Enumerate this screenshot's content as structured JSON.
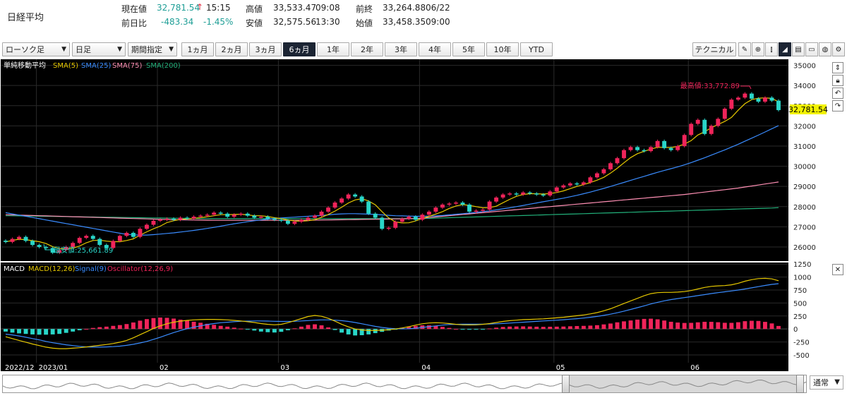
{
  "quote": {
    "title": "日経平均",
    "current_label": "現在値",
    "current_value": "32,781.54",
    "current_arrow": "↑",
    "current_time": "15:15",
    "high_label": "高値",
    "high_value": "33,533.47",
    "high_time": "09:08",
    "prev_label": "前終",
    "prev_value": "33,264.88",
    "prev_date": "06/22",
    "change_label": "前日比",
    "change_value": "-483.34",
    "change_pct": "-1.45%",
    "low_label": "安値",
    "low_value": "32,575.56",
    "low_time": "13:30",
    "open_label": "始値",
    "open_value": "33,458.35",
    "open_time": "09:00"
  },
  "toolbar": {
    "chart_type": "ローソク足",
    "interval": "日足",
    "period_select": "期間指定",
    "periods": [
      "1ヵ月",
      "2ヵ月",
      "3ヵ月",
      "6ヵ月",
      "1年",
      "2年",
      "3年",
      "4年",
      "5年",
      "10年",
      "YTD"
    ],
    "active_period": "6ヵ月",
    "technical": "テクニカル"
  },
  "navigator": {
    "mode": "通常"
  },
  "colors": {
    "background": "#000000",
    "up": "#f0245a",
    "down": "#29d6c8",
    "sma5": "#e6c800",
    "sma25": "#3a8cff",
    "sma75": "#ff8fb4",
    "sma200": "#22b07a",
    "macd": "#e6c800",
    "signal": "#3a8cff",
    "osc_pos": "#f0245a",
    "osc_neg": "#29d6c8"
  },
  "chart_data": [
    {
      "type": "candlestick",
      "legend": [
        "単純移動平均",
        "SMA(5)",
        "SMA(25)",
        "SMA(75)",
        "SMA(200)"
      ],
      "ylim": [
        25300,
        35300
      ],
      "yticks": [
        26000,
        27000,
        28000,
        29000,
        30000,
        31000,
        32000,
        33000,
        34000,
        35000
      ],
      "ytick_labels": [
        "26000",
        "27000",
        "28000",
        "29000",
        "30000",
        "31000",
        "32000",
        "33000",
        "34000",
        "35000"
      ],
      "x_labels": [
        "2022/12",
        "2023/01",
        "02",
        "03",
        "04",
        "05",
        "06"
      ],
      "current_price_label": "32,781.54",
      "annotations": {
        "high": "最高値:33,772.89",
        "low": "最安値:25,661.89"
      },
      "close": [
        26250,
        26400,
        26500,
        26300,
        26100,
        26000,
        25950,
        25716,
        25850,
        26000,
        26200,
        26450,
        26550,
        26400,
        26100,
        25950,
        26300,
        26550,
        26700,
        26500,
        26900,
        27100,
        27300,
        27350,
        27400,
        27350,
        27450,
        27400,
        27500,
        27550,
        27600,
        27700,
        27650,
        27500,
        27600,
        27650,
        27550,
        27450,
        27500,
        27400,
        27350,
        27300,
        27150,
        27250,
        27350,
        27450,
        27550,
        27750,
        27950,
        28200,
        28400,
        28600,
        28500,
        28250,
        27650,
        27450,
        26900,
        26950,
        27250,
        27400,
        27500,
        27350,
        27600,
        27750,
        27950,
        28100,
        28150,
        28200,
        28100,
        27750,
        27800,
        27850,
        28250,
        28450,
        28600,
        28650,
        28600,
        28700,
        28650,
        28600,
        28550,
        28750,
        28950,
        29050,
        29150,
        29100,
        29200,
        29450,
        29650,
        29850,
        30150,
        30400,
        30800,
        30950,
        30800,
        30750,
        30950,
        31250,
        30900,
        30800,
        31000,
        31550,
        32100,
        32300,
        31600,
        32000,
        32350,
        32850,
        33300,
        33400,
        33600,
        33350,
        33200,
        33400,
        33250,
        32781.54
      ],
      "sma25": [
        27700,
        27640,
        27580,
        27520,
        27460,
        27400,
        27340,
        27280,
        27220,
        27160,
        27100,
        27040,
        26980,
        26920,
        26860,
        26800,
        26740,
        26680,
        26620,
        26600,
        26590,
        26590,
        26610,
        26640,
        26670,
        26700,
        26740,
        26780,
        26820,
        26870,
        26920,
        26970,
        27030,
        27090,
        27150,
        27200,
        27250,
        27300,
        27340,
        27380,
        27410,
        27440,
        27460,
        27480,
        27500,
        27520,
        27540,
        27560,
        27590,
        27620,
        27640,
        27650,
        27650,
        27640,
        27630,
        27610,
        27590,
        27570,
        27550,
        27540,
        27530,
        27520,
        27520,
        27530,
        27540,
        27560,
        27590,
        27620,
        27650,
        27680,
        27710,
        27750,
        27790,
        27840,
        27890,
        27940,
        28000,
        28060,
        28120,
        28180,
        28240,
        28300,
        28360,
        28420,
        28490,
        28560,
        28640,
        28720,
        28810,
        28900,
        29000,
        29100,
        29200,
        29300,
        29400,
        29500,
        29600,
        29700,
        29790,
        29880,
        29970,
        30070,
        30180,
        30300,
        30420,
        30550,
        30680,
        30810,
        30950,
        31090,
        31240,
        31390,
        31540,
        31700,
        31860,
        32010
      ],
      "sma75": [
        27600,
        27590,
        27580,
        27570,
        27560,
        27550,
        27540,
        27530,
        27520,
        27510,
        27500,
        27490,
        27480,
        27470,
        27460,
        27450,
        27440,
        27430,
        27420,
        27410,
        27400,
        27390,
        27380,
        27370,
        27360,
        27350,
        27345,
        27340,
        27335,
        27330,
        27325,
        27320,
        27320,
        27320,
        27320,
        27320,
        27320,
        27320,
        27320,
        27320,
        27320,
        27320,
        27320,
        27320,
        27320,
        27325,
        27330,
        27335,
        27340,
        27345,
        27350,
        27355,
        27360,
        27365,
        27370,
        27375,
        27380,
        27385,
        27390,
        27395,
        27400,
        27410,
        27430,
        27460,
        27490,
        27520,
        27550,
        27580,
        27610,
        27640,
        27670,
        27700,
        27730,
        27760,
        27790,
        27820,
        27850,
        27880,
        27910,
        27940,
        27970,
        28000,
        28030,
        28060,
        28090,
        28120,
        28150,
        28180,
        28210,
        28240,
        28270,
        28300,
        28330,
        28360,
        28390,
        28420,
        28450,
        28480,
        28510,
        28540,
        28570,
        28600,
        28640,
        28680,
        28720,
        28760,
        28800,
        28840,
        28880,
        28920,
        28970,
        29020,
        29070,
        29120,
        29170,
        29220
      ],
      "sma200": [
        27550,
        27545,
        27540,
        27535,
        27530,
        27525,
        27520,
        27515,
        27510,
        27505,
        27500,
        27495,
        27490,
        27485,
        27480,
        27475,
        27470,
        27465,
        27460,
        27455,
        27450,
        27445,
        27440,
        27435,
        27430,
        27425,
        27420,
        27415,
        27410,
        27405,
        27400,
        27400,
        27400,
        27400,
        27400,
        27400,
        27400,
        27400,
        27400,
        27400,
        27400,
        27400,
        27400,
        27400,
        27400,
        27400,
        27400,
        27400,
        27400,
        27400,
        27400,
        27400,
        27400,
        27400,
        27400,
        27400,
        27400,
        27400,
        27400,
        27400,
        27400,
        27400,
        27410,
        27420,
        27430,
        27440,
        27450,
        27460,
        27470,
        27480,
        27490,
        27500,
        27510,
        27520,
        27530,
        27540,
        27550,
        27560,
        27570,
        27580,
        27590,
        27600,
        27610,
        27620,
        27630,
        27640,
        27650,
        27660,
        27670,
        27680,
        27690,
        27700,
        27710,
        27720,
        27730,
        27740,
        27750,
        27760,
        27770,
        27780,
        27790,
        27800,
        27810,
        27820,
        27830,
        27840,
        27850,
        27860,
        27870,
        27880,
        27890,
        27900,
        27910,
        27920,
        27930,
        27950
      ]
    },
    {
      "type": "macd",
      "legend": [
        "MACD",
        "MACD(12,26)",
        "Signal(9)",
        "Oscillator(12,26,9)"
      ],
      "ylim": [
        -650,
        1280
      ],
      "yticks": [
        -500,
        -250,
        0,
        250,
        500,
        750,
        1000,
        1250
      ],
      "ytick_labels": [
        "-500",
        "-250",
        "0",
        "250",
        "500",
        "750",
        "1000",
        "1250"
      ],
      "macd": [
        -150,
        -185,
        -220,
        -255,
        -290,
        -320,
        -350,
        -370,
        -380,
        -380,
        -370,
        -360,
        -345,
        -330,
        -315,
        -300,
        -280,
        -255,
        -220,
        -170,
        -110,
        -50,
        10,
        60,
        100,
        130,
        150,
        165,
        175,
        180,
        185,
        185,
        180,
        175,
        165,
        155,
        140,
        125,
        105,
        90,
        80,
        90,
        120,
        160,
        200,
        240,
        260,
        245,
        205,
        150,
        90,
        40,
        0,
        -20,
        -30,
        -30,
        -25,
        -15,
        0,
        20,
        45,
        75,
        100,
        115,
        120,
        115,
        105,
        90,
        80,
        78,
        80,
        90,
        105,
        125,
        145,
        160,
        170,
        180,
        185,
        190,
        195,
        205,
        215,
        225,
        240,
        255,
        270,
        290,
        315,
        350,
        390,
        440,
        490,
        540,
        590,
        640,
        680,
        700,
        705,
        705,
        710,
        720,
        740,
        770,
        800,
        820,
        830,
        835,
        850,
        880,
        920,
        950,
        970,
        975,
        965,
        930
      ],
      "signal": [
        -100,
        -115,
        -135,
        -160,
        -185,
        -210,
        -240,
        -265,
        -285,
        -305,
        -320,
        -335,
        -345,
        -350,
        -350,
        -345,
        -340,
        -330,
        -315,
        -295,
        -270,
        -240,
        -200,
        -160,
        -115,
        -70,
        -30,
        5,
        35,
        60,
        85,
        105,
        120,
        130,
        140,
        148,
        152,
        155,
        155,
        152,
        148,
        145,
        145,
        148,
        155,
        162,
        170,
        175,
        175,
        170,
        160,
        145,
        125,
        100,
        75,
        50,
        30,
        15,
        5,
        2,
        5,
        15,
        30,
        45,
        60,
        75,
        85,
        90,
        92,
        92,
        92,
        93,
        96,
        100,
        106,
        114,
        122,
        130,
        138,
        146,
        154,
        162,
        170,
        178,
        188,
        198,
        210,
        225,
        242,
        262,
        285,
        312,
        343,
        376,
        410,
        446,
        482,
        514,
        542,
        566,
        586,
        604,
        622,
        642,
        662,
        682,
        700,
        716,
        732,
        750,
        770,
        792,
        815,
        838,
        858,
        872
      ]
    }
  ]
}
